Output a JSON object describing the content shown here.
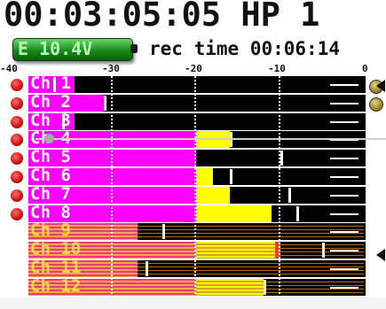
{
  "header": {
    "timecode": "00:03:05:05",
    "hp_label": "HP 1",
    "battery_label": "E 10.4V",
    "rec_time_label": "rec time",
    "rec_time_value": "00:06:14"
  },
  "meter_scale": {
    "labels": [
      "-40",
      "-30",
      "-20",
      "-10",
      "0"
    ],
    "min_db": -40,
    "max_db": 0
  },
  "colors": {
    "armed": "#ff00ff",
    "unarmed_stripe": "#e63c7d",
    "unarmed_stripe_alt": "#f2a54a",
    "level": "#ffff00",
    "overload": "#ff3b1f",
    "record_dot": "#cc1010"
  },
  "channels": [
    {
      "label": "Ch 1",
      "armed": true,
      "selected": true,
      "signal_db": -40,
      "peak_db": -37,
      "overload": false
    },
    {
      "label": "Ch 2",
      "armed": true,
      "selected": false,
      "signal_db": -31,
      "peak_db": -31,
      "overload": false
    },
    {
      "label": "Ch 3",
      "armed": true,
      "selected": false,
      "signal_db": -40,
      "peak_db": -36,
      "overload": false
    },
    {
      "label": "Ch 4",
      "armed": true,
      "selected": false,
      "signal_db": -16,
      "peak_db": -16,
      "overload": false
    },
    {
      "label": "Ch 5",
      "armed": true,
      "selected": false,
      "signal_db": -20,
      "peak_db": -10,
      "overload": false
    },
    {
      "label": "Ch 6",
      "armed": true,
      "selected": false,
      "signal_db": -18,
      "peak_db": -16,
      "overload": false
    },
    {
      "label": "Ch 7",
      "armed": true,
      "selected": false,
      "signal_db": -16,
      "peak_db": -9,
      "overload": false
    },
    {
      "label": "Ch 8",
      "armed": true,
      "selected": false,
      "signal_db": -11,
      "peak_db": -8,
      "overload": false
    },
    {
      "label": "Ch 9",
      "armed": false,
      "selected": false,
      "signal_db": -27,
      "peak_db": -24,
      "overload": false
    },
    {
      "label": "Ch 10",
      "armed": false,
      "selected": false,
      "signal_db": -10,
      "peak_db": -5,
      "overload": true
    },
    {
      "label": "Ch 11",
      "armed": false,
      "selected": false,
      "signal_db": -27,
      "peak_db": -26,
      "overload": false
    },
    {
      "label": "Ch 12",
      "armed": false,
      "selected": false,
      "signal_db": -12,
      "peak_db": -12,
      "overload": false
    }
  ],
  "icons": {
    "record_dot": "record-dot-icon",
    "side_knob": "knob-icon",
    "arrow": "arrow-left-icon"
  }
}
